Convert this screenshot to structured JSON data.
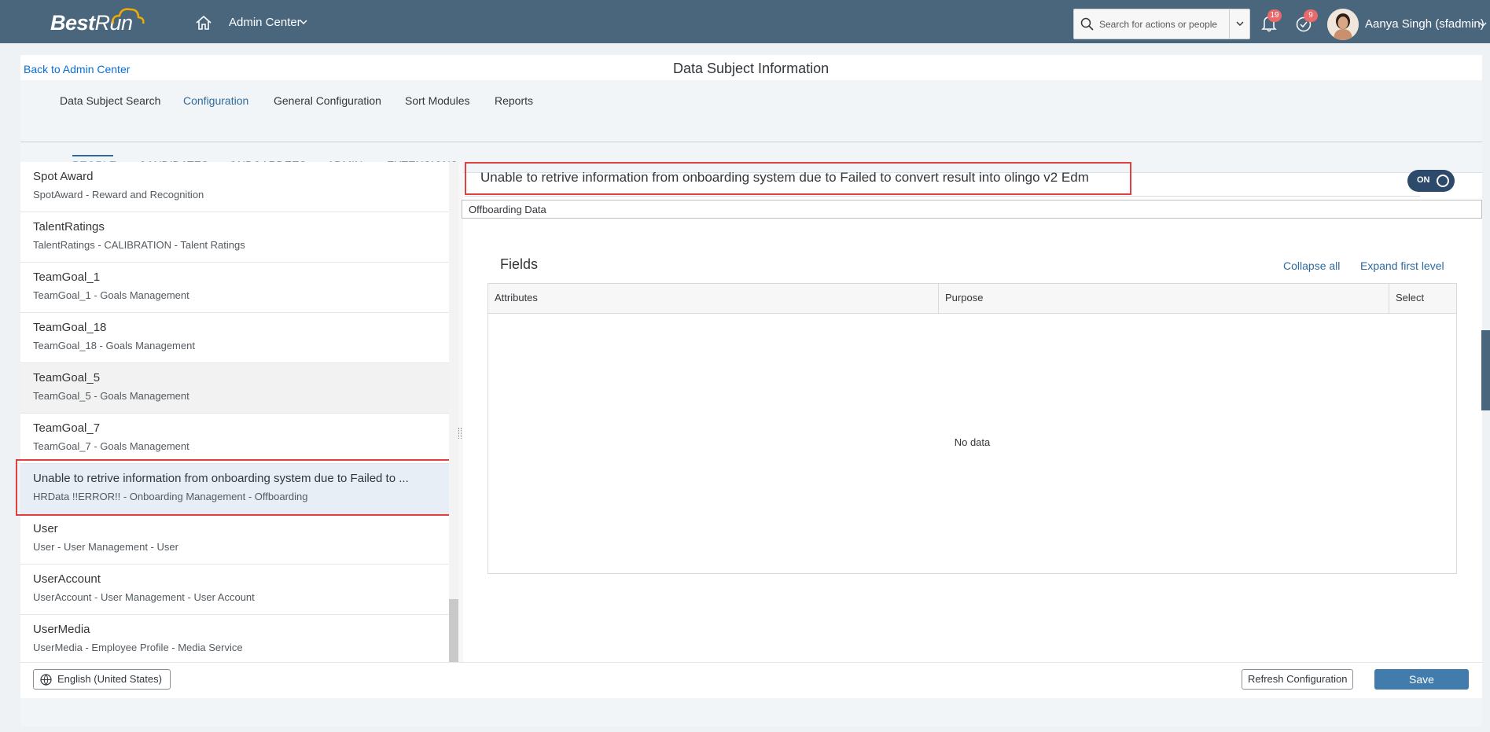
{
  "shell": {
    "logo_best": "Best",
    "logo_run": "Run",
    "nav_title": "Admin Center",
    "search_placeholder": "Search for actions or people",
    "notifications_count": "19",
    "todo_count": "9",
    "user_name": "Aanya Singh (sfadmin)"
  },
  "page": {
    "back_link": "Back to Admin Center",
    "title": "Data Subject Information"
  },
  "tabs": [
    "Data Subject Search",
    "Configuration",
    "General Configuration",
    "Sort Modules",
    "Reports"
  ],
  "active_tab": "Configuration",
  "subtabs": [
    "PEOPLE",
    "CANDIDATES",
    "ONBOARDEES",
    "ADMIN",
    "EXTENSIONS"
  ],
  "active_subtab": "PEOPLE",
  "list": {
    "items": [
      {
        "title": "Spot Award",
        "subtitle": "SpotAward - Reward and Recognition"
      },
      {
        "title": "TalentRatings",
        "subtitle": "TalentRatings - CALIBRATION - Talent Ratings"
      },
      {
        "title": "TeamGoal_1",
        "subtitle": "TeamGoal_1 - Goals Management"
      },
      {
        "title": "TeamGoal_18",
        "subtitle": "TeamGoal_18 - Goals Management"
      },
      {
        "title": "TeamGoal_5",
        "subtitle": "TeamGoal_5 - Goals Management"
      },
      {
        "title": "TeamGoal_7",
        "subtitle": "TeamGoal_7 - Goals Management"
      },
      {
        "title": "Unable to retrive information from onboarding system due to Failed to ...",
        "subtitle": "HRData !!ERROR!! - Onboarding Management - Offboarding"
      },
      {
        "title": "User",
        "subtitle": "User - User Management - User"
      },
      {
        "title": "UserAccount",
        "subtitle": "UserAccount - User Management - User Account"
      },
      {
        "title": "UserMedia",
        "subtitle": "UserMedia - Employee Profile - Media Service"
      }
    ]
  },
  "detail": {
    "title": "Unable to retrive information from onboarding system due to Failed to convert result into olingo v2 Edm",
    "toggle_label": "ON",
    "subject_value": "Offboarding Data",
    "fields_heading": "Fields",
    "collapse_all": "Collapse all",
    "expand_first": "Expand first level",
    "columns": [
      "Attributes",
      "Purpose",
      "Select"
    ],
    "empty_text": "No data"
  },
  "footer": {
    "language": "English (United States)",
    "refresh": "Refresh Configuration",
    "save": "Save"
  },
  "colors": {
    "shell_bar": "#4a667d",
    "accent": "#2e6a9e",
    "save_button": "#427cac",
    "highlight_box": "#e0403f",
    "badge": "#e86a6a"
  }
}
